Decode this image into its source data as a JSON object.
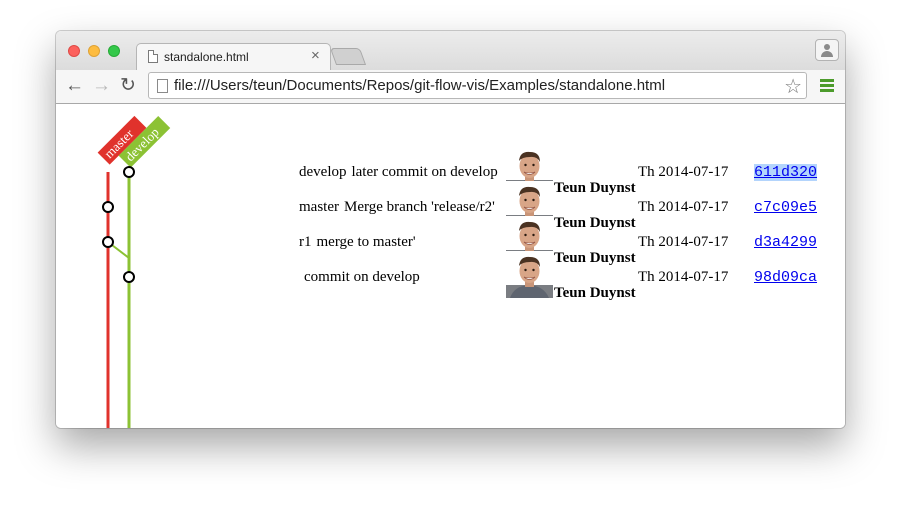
{
  "browser": {
    "tab": {
      "title": "standalone.html",
      "close_glyph": "×"
    },
    "address": "file:///Users/teun/Documents/Repos/git-flow-vis/Examples/standalone.html",
    "nav": {
      "back": "←",
      "forward": "→",
      "reload": "↻"
    },
    "star_glyph": "☆"
  },
  "graph": {
    "branches": [
      {
        "name": "master",
        "color": "#e0322c"
      },
      {
        "name": "develop",
        "color": "#8cc234"
      }
    ]
  },
  "commits": [
    {
      "branch_label": "develop",
      "message": "later commit on develop",
      "author": "Teun Duynstee",
      "date": "Th 2014-07-17",
      "sha": "611d320",
      "selected": true
    },
    {
      "branch_label": "master",
      "message": "Merge branch 'release/r2'",
      "author": "Teun Duynstee",
      "date": "Th 2014-07-17",
      "sha": "c7c09e5",
      "selected": false
    },
    {
      "branch_label": "r1",
      "message": "merge to master'",
      "author": "Teun Duynstee",
      "date": "Th 2014-07-17",
      "sha": "d3a4299",
      "selected": false
    },
    {
      "branch_label": "",
      "message": "commit on develop",
      "author": "Teun Duynstee",
      "date": "Th 2014-07-17",
      "sha": "98d09ca",
      "selected": false
    }
  ]
}
